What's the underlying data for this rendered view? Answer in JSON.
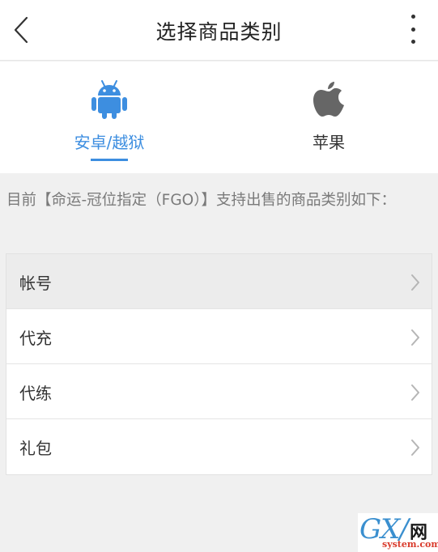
{
  "header": {
    "title": "选择商品类别",
    "back_icon": "chevron-left-icon",
    "more_icon": "more-vertical-icon"
  },
  "platforms": [
    {
      "label": "安卓/越狱",
      "icon": "android-icon",
      "selected": true
    },
    {
      "label": "苹果",
      "icon": "apple-icon",
      "selected": false
    }
  ],
  "notice": "目前【命运-冠位指定（FGO）】支持出售的商品类别如下：",
  "categories": [
    {
      "label": "帐号"
    },
    {
      "label": "代充"
    },
    {
      "label": "代练"
    },
    {
      "label": "礼包"
    }
  ],
  "watermark": {
    "main": "GX/",
    "cn": "网",
    "sub": "system.com"
  },
  "colors": {
    "accent": "#3d8ee0",
    "background": "#f0f0f0",
    "apple_icon": "#666666"
  }
}
